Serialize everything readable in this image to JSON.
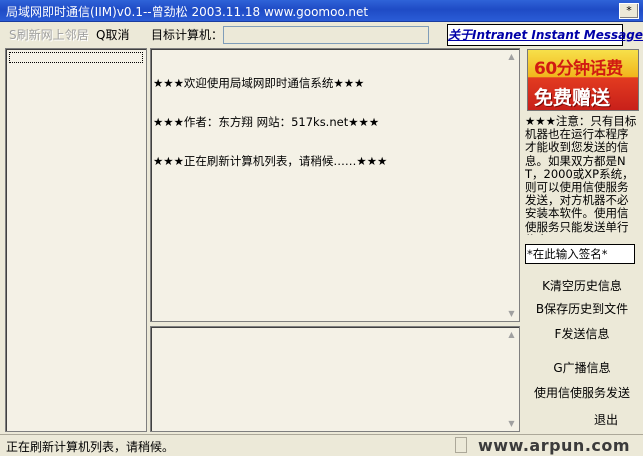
{
  "window": {
    "title": "局域网即时通信(IIM)v0.1--曾劲松 2003.11.18 www.goomoo.net",
    "close_button": "*"
  },
  "toolbar": {
    "refresh_label": "S刷新网上邻居",
    "cancel_label": "Q取消",
    "target_label": "目标计算机：",
    "target_value": "",
    "about_label": "关于Intranet Instant Message"
  },
  "messages": {
    "lines": [
      "★★★欢迎使用局域网即时通信系统★★★",
      "★★★作者：东方翔 网站：517ks.net★★★",
      "★★★正在刷新计算机列表，请稍候……★★★"
    ]
  },
  "banner": {
    "top_text": "60分钟话费",
    "bottom_text": "免费赠送"
  },
  "notice": {
    "text": "★★★注意：只有目标机器也在运行本程序才能收到您发送的信息。如果双方都是NT，2000或XP系统，则可以使用信使服务发送，对方机器不必安装本软件。使用信使服务只能发送单行信息。"
  },
  "signature": {
    "value": "*在此输入签名*"
  },
  "actions": {
    "clear_history": "K清空历史信息",
    "save_history": "B保存历史到文件",
    "send": "F发送信息",
    "broadcast": "G广播信息",
    "messenger_send": "使用信使服务发送",
    "exit": "退出"
  },
  "status": {
    "text": "正在刷新计算机列表，请稍候。",
    "watermark": "www.arpun.com"
  },
  "colors": {
    "titlebar": "#2458d1",
    "window_bg": "#ece9d8",
    "about_link": "#0000a8",
    "banner_red": "#c8201a"
  }
}
